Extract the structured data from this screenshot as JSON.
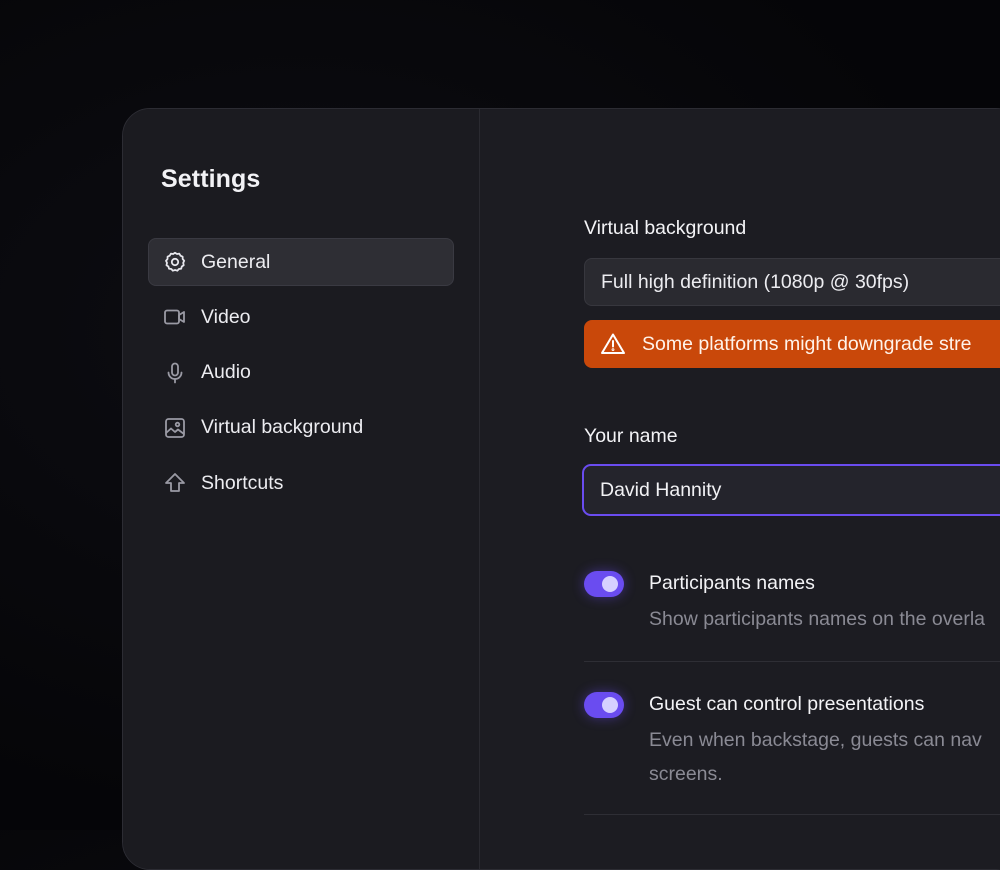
{
  "sidebar": {
    "title": "Settings",
    "items": [
      {
        "label": "General",
        "icon": "gear-icon",
        "active": true
      },
      {
        "label": "Video",
        "icon": "video-icon"
      },
      {
        "label": "Audio",
        "icon": "microphone-icon"
      },
      {
        "label": "Virtual background",
        "icon": "image-icon"
      },
      {
        "label": "Shortcuts",
        "icon": "shortcut-icon"
      }
    ]
  },
  "main": {
    "virtual_background": {
      "label": "Virtual background",
      "selected": "Full high definition (1080p @ 30fps)",
      "warning": "Some platforms might downgrade stre"
    },
    "name": {
      "label": "Your name",
      "value": "David Hannity"
    },
    "options": [
      {
        "title": "Participants names",
        "description": "Show participants names on the overla",
        "enabled": true
      },
      {
        "title": "Guest can control presentations",
        "description_line1": "Even when backstage, guests can nav",
        "description_line2": "screens.",
        "enabled": true
      }
    ]
  },
  "colors": {
    "accent": "#6a4cf0",
    "warning": "#c9480a"
  }
}
